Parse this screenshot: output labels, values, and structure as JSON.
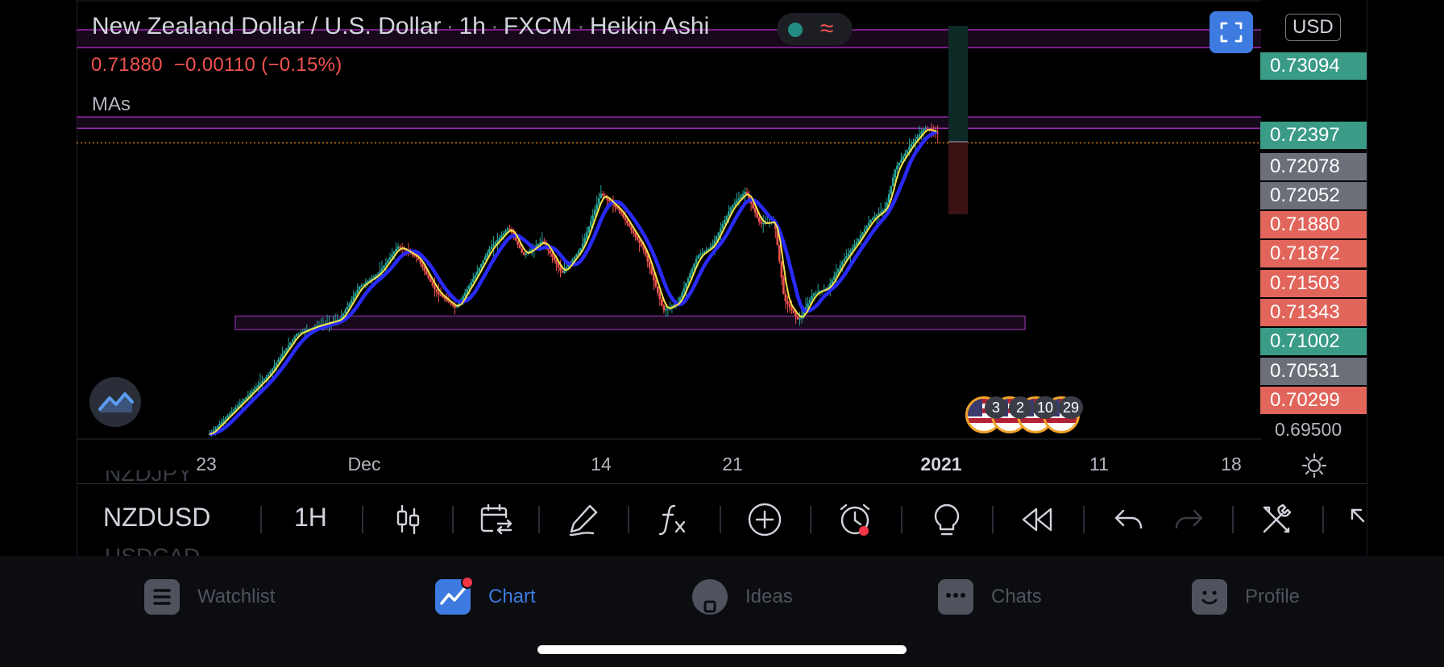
{
  "legend": {
    "symbol_name": "New Zealand Dollar / U.S. Dollar",
    "interval": "1h",
    "exchange": "FXCM",
    "chart_style": "Heikin Ashi",
    "separator": "·",
    "last_price": "0.71880",
    "change": "−0.00110 (−0.15%)",
    "indicator": "MAs"
  },
  "currency": "USD",
  "price_axis": {
    "ticks": [
      "0.69500"
    ],
    "labels": [
      {
        "text": "0.73094",
        "color": "#3a9b87"
      },
      {
        "text": "0.72397",
        "color": "#3a9b87"
      },
      {
        "text": "0.72078",
        "color": "#6c6f78"
      },
      {
        "text": "0.72052",
        "color": "#6c6f78"
      },
      {
        "text": "0.71880",
        "color": "#e2655b"
      },
      {
        "text": "0.71872",
        "color": "#e2655b"
      },
      {
        "text": "0.71503",
        "color": "#e2655b"
      },
      {
        "text": "0.71343",
        "color": "#e2655b"
      },
      {
        "text": "0.71002",
        "color": "#3a9b87"
      },
      {
        "text": "0.70531",
        "color": "#6c6f78"
      },
      {
        "text": "0.70299",
        "color": "#e2655b"
      }
    ]
  },
  "time_axis": [
    "23",
    "Dec",
    "14",
    "21",
    "2021",
    "11",
    "18"
  ],
  "events": {
    "counts": [
      "3",
      "2",
      "10",
      "29"
    ]
  },
  "toolbar": {
    "symbol": "NZDUSD",
    "ghost_prev": "NZDJPY",
    "ghost_next": "USDCAD",
    "interval": "1H"
  },
  "nav": {
    "watchlist": "Watchlist",
    "chart": "Chart",
    "ideas": "Ideas",
    "chats": "Chats",
    "profile": "Profile"
  },
  "chart_data": {
    "type": "candlestick",
    "style": "Heikin Ashi",
    "ylim": [
      0.6941,
      0.7332
    ],
    "yticks": [
      "0.69500"
    ],
    "x_tick_labels": [
      "23",
      "Dec",
      "14",
      "21",
      "2021",
      "11",
      "18"
    ],
    "close_path": [
      [
        0,
        0.6946
      ],
      [
        6,
        0.6972
      ],
      [
        12,
        0.6998
      ],
      [
        18,
        0.7035
      ],
      [
        22,
        0.7042
      ],
      [
        27,
        0.7048
      ],
      [
        31,
        0.7077
      ],
      [
        35,
        0.7089
      ],
      [
        39,
        0.7113
      ],
      [
        43,
        0.7103
      ],
      [
        47,
        0.7072
      ],
      [
        51,
        0.7058
      ],
      [
        55,
        0.7087
      ],
      [
        58,
        0.7111
      ],
      [
        62,
        0.713
      ],
      [
        65,
        0.7105
      ],
      [
        69,
        0.7118
      ],
      [
        73,
        0.7089
      ],
      [
        77,
        0.7112
      ],
      [
        81,
        0.716
      ],
      [
        85,
        0.7144
      ],
      [
        90,
        0.7109
      ],
      [
        94,
        0.7056
      ],
      [
        97,
        0.7063
      ],
      [
        101,
        0.7104
      ],
      [
        104,
        0.7113
      ],
      [
        108,
        0.7148
      ],
      [
        111,
        0.7162
      ],
      [
        114,
        0.7133
      ],
      [
        117,
        0.7135
      ],
      [
        119,
        0.7066
      ],
      [
        122,
        0.7047
      ],
      [
        125,
        0.7071
      ],
      [
        128,
        0.7076
      ],
      [
        131,
        0.7099
      ],
      [
        134,
        0.7117
      ],
      [
        137,
        0.7137
      ],
      [
        140,
        0.7147
      ],
      [
        142,
        0.7182
      ],
      [
        145,
        0.7202
      ],
      [
        148,
        0.7218
      ],
      [
        151,
        0.7213
      ]
    ],
    "moving_averages": [
      {
        "color": "#2a2aff"
      },
      {
        "color": "#f7e24b"
      }
    ],
    "horizontal_levels": [
      0.7228,
      0.7218,
      0.7205
    ],
    "zone": {
      "from": 0.7039,
      "to": 0.7051
    },
    "position_tool": {
      "entry": 0.7206,
      "target": 0.7309,
      "stop": 0.719
    }
  }
}
